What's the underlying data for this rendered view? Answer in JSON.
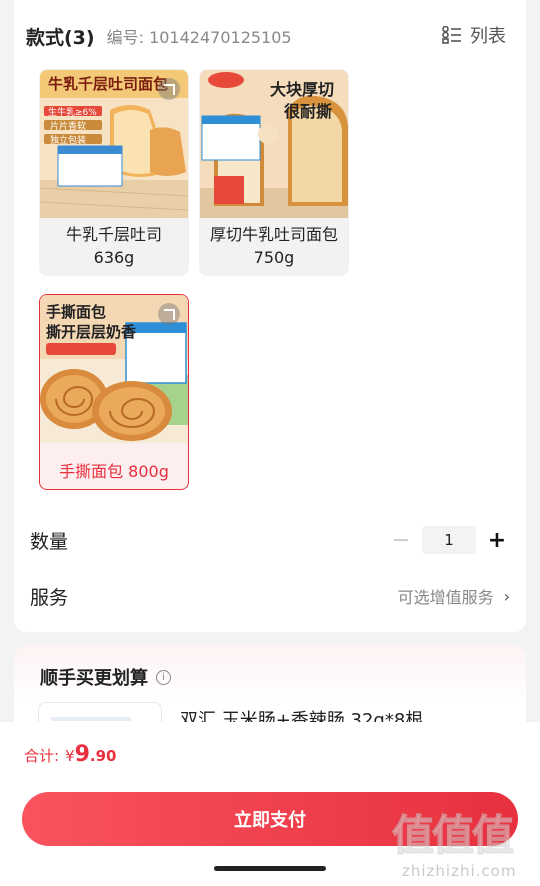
{
  "style_section": {
    "title": "款式(3)",
    "sku_number": "编号: 10142470125105",
    "list_toggle_label": "列表"
  },
  "variants": [
    {
      "label": "牛乳千层吐司636g",
      "badge_lines": [
        "牛乳千层吐司面包",
        "生牛乳≥6%",
        "片片香软",
        "独立包装"
      ],
      "selected": false
    },
    {
      "label": "厚切牛乳吐司面包750g",
      "badge_lines": [
        "大块厚切",
        "很耐撕"
      ],
      "selected": false
    },
    {
      "label": "手撕面包 800g",
      "badge_lines": [
        "手撕面包",
        "撕开层层奶香"
      ],
      "selected": true
    }
  ],
  "quantity": {
    "label": "数量",
    "value": "1",
    "minus": "−",
    "plus": "+"
  },
  "service": {
    "label": "服务",
    "value": "可选增值服务",
    "chevron": "›"
  },
  "addon": {
    "title": "顺手买更划算",
    "info_icon": "i",
    "item_name": "双汇 玉米肠+香辣肠 32g*8根"
  },
  "checkout": {
    "total_label": "合计:",
    "currency": "¥",
    "price_int": "9",
    "price_dec": ".90",
    "pay_label": "立即支付"
  },
  "watermark": {
    "chars": "值值值",
    "url": "zhizhizhi.com"
  },
  "colors": {
    "accent": "#e8303f",
    "accent_light": "#fdeff0",
    "text": "#222222",
    "muted": "#888888"
  }
}
